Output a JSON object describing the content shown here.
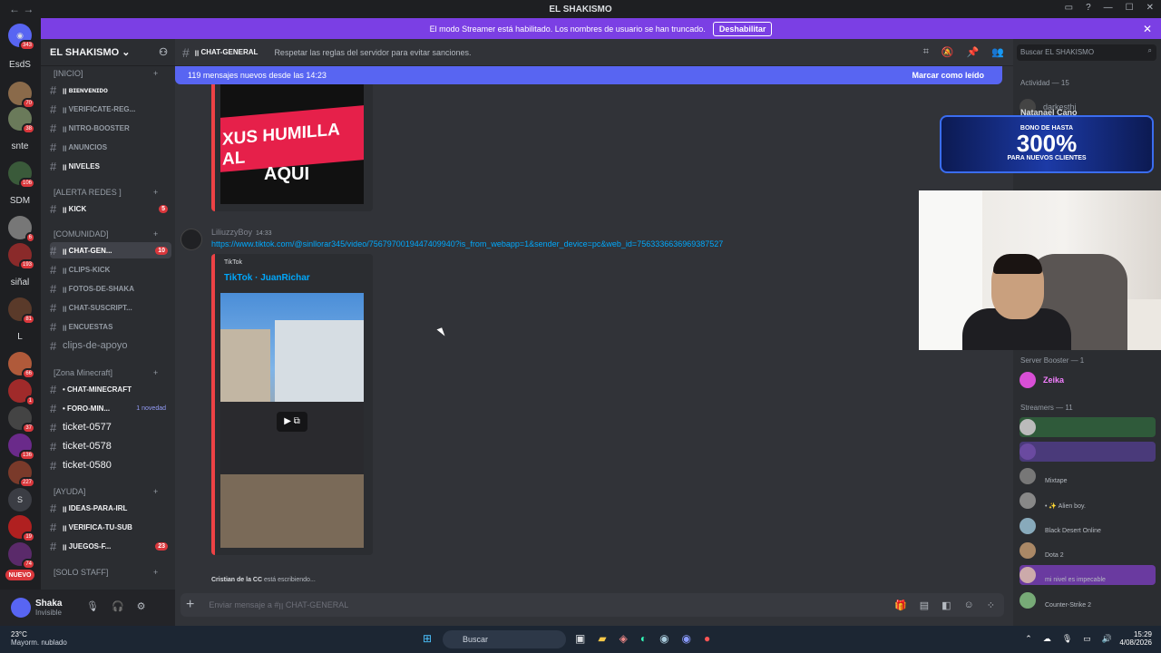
{
  "window": {
    "title": "EL SHAKISMO"
  },
  "streamer_banner": {
    "text": "El modo Streamer está habilitado. Los nombres de usuario se han truncado.",
    "button": "Deshabilitar"
  },
  "servers": [
    {
      "label": "",
      "badge": "343"
    },
    {
      "label": "EsdS",
      "badge": ""
    },
    {
      "label": "",
      "badge": "70"
    },
    {
      "label": "",
      "badge": "38"
    },
    {
      "label": "snte",
      "badge": ""
    },
    {
      "label": "",
      "badge": "106"
    },
    {
      "label": "SDM",
      "badge": ""
    },
    {
      "label": "",
      "badge": "6"
    },
    {
      "label": "",
      "badge": "193"
    },
    {
      "label": "siñal",
      "badge": ""
    },
    {
      "label": "",
      "badge": "81"
    },
    {
      "label": "L",
      "badge": ""
    },
    {
      "label": "",
      "badge": "66"
    },
    {
      "label": "",
      "badge": "1"
    },
    {
      "label": "",
      "badge": "37"
    },
    {
      "label": "",
      "badge": "136"
    },
    {
      "label": "",
      "badge": "227"
    },
    {
      "label": "S",
      "badge": ""
    },
    {
      "label": "",
      "badge": "19"
    },
    {
      "label": "",
      "badge": "74"
    },
    {
      "label": "NUEVO",
      "badge": ""
    }
  ],
  "guild": {
    "name": "EL SHAKISMO"
  },
  "categories": [
    {
      "name": "[INICIO]"
    },
    {
      "name": "[ALERTA REDES ]"
    },
    {
      "name": "[COMUNIDAD]"
    },
    {
      "name": "[Zona Minecraft]"
    },
    {
      "name": "[AYUDA]"
    },
    {
      "name": "[SOLO STAFF]"
    }
  ],
  "channels": [
    {
      "name": "ꞁꞁ ʙɪᴇɴᴠᴇɴɪᴅᴏ",
      "badge": ""
    },
    {
      "name": "ꞁꞁ VERIFICATE-REG...",
      "badge": ""
    },
    {
      "name": "ꞁꞁ NITRO-BOOSTER",
      "badge": ""
    },
    {
      "name": "ꞁꞁ ANUNCIOS",
      "badge": ""
    },
    {
      "name": "ꞁꞁ NIVELES",
      "badge": ""
    },
    {
      "name": "ꞁꞁ KICK",
      "badge": "5"
    },
    {
      "name": "ꞁꞁ CHAT-GEN...",
      "badge": "10"
    },
    {
      "name": "ꞁꞁ CLIPS-KICK",
      "badge": ""
    },
    {
      "name": "ꞁꞁ FOTOS-DE-SHAKA",
      "badge": ""
    },
    {
      "name": "ꞁꞁ CHAT-SUSCRIPT...",
      "badge": ""
    },
    {
      "name": "ꞁꞁ ENCUESTAS",
      "badge": ""
    },
    {
      "name": "clips-de-apoyo",
      "badge": ""
    },
    {
      "name": "• CHAT-MINECRAFT",
      "badge": ""
    },
    {
      "name": "• FORO-MIN...",
      "badge": "1 novedad"
    },
    {
      "name": "ticket-0577",
      "badge": ""
    },
    {
      "name": "ticket-0578",
      "badge": ""
    },
    {
      "name": "ticket-0580",
      "badge": ""
    },
    {
      "name": "ꞁꞁ IDEAS-PARA-IRL",
      "badge": ""
    },
    {
      "name": "ꞁꞁ VERIFICA-TU-SUB",
      "badge": ""
    },
    {
      "name": "ꞁꞁ JUEGOS-F...",
      "badge": "23"
    }
  ],
  "user": {
    "name": "Shaka",
    "status": "Invisible"
  },
  "channel_header": {
    "name": "ꞁꞁ CHAT-GENERAL",
    "topic": "Respetar las reglas del servidor para evitar sanciones."
  },
  "new_messages": {
    "text": "119 mensajes nuevos desde las 14:23",
    "action": "Marcar como leído"
  },
  "embed1": {
    "line1": "XUS HUMILLA AL",
    "line2": "AQUI"
  },
  "message": {
    "author": "LiliuzzyBoy",
    "time": "14:33",
    "link": "https://www.tiktok.com/@sinllorar345/video/7567970019447409940?is_from_webapp=1&sender_device=pc&web_id=7563336636969387527",
    "embed_provider": "TikTok",
    "embed_title": "TikTok · JuanRichar"
  },
  "typing": {
    "user": "Cristian de la CC",
    "text": "está escribiendo..."
  },
  "composer": {
    "placeholder": "Enviar mensaje a #ꞁꞁ CHAT-GENERAL"
  },
  "members": {
    "search_placeholder": "Buscar EL SHAKISMO",
    "activity": "Actividad — 15",
    "activity_items": [
      {
        "name": "darkesthj",
        "sub": ""
      },
      {
        "name": "Natanael Cano",
        "sub": ""
      }
    ],
    "booster_header": "Server Booster — 1",
    "boosters": [
      {
        "name": "Zeika",
        "color": "#f47fff"
      }
    ],
    "streamers_header": "Streamers — 11",
    "streamers": [
      {
        "name": "",
        "sub": ""
      },
      {
        "name": "",
        "sub": ""
      },
      {
        "name": "",
        "sub": "Mixtape"
      },
      {
        "name": "",
        "sub": "• ✨ Alien boy."
      },
      {
        "name": "",
        "sub": "Black Desert Online"
      },
      {
        "name": "",
        "sub": "Dota 2"
      },
      {
        "name": "",
        "sub": "mi nivel es impecable"
      },
      {
        "name": "",
        "sub": "Counter-Strike 2"
      }
    ]
  },
  "ad": {
    "line1": "BONO DE HASTA",
    "line2": "300%",
    "line3": "PARA NUEVOS CLIENTES"
  },
  "taskbar": {
    "temp": "23°C",
    "weather": "Mayorm. nublado",
    "search": "Buscar",
    "time": "15:29",
    "date": "4/08/2026"
  }
}
